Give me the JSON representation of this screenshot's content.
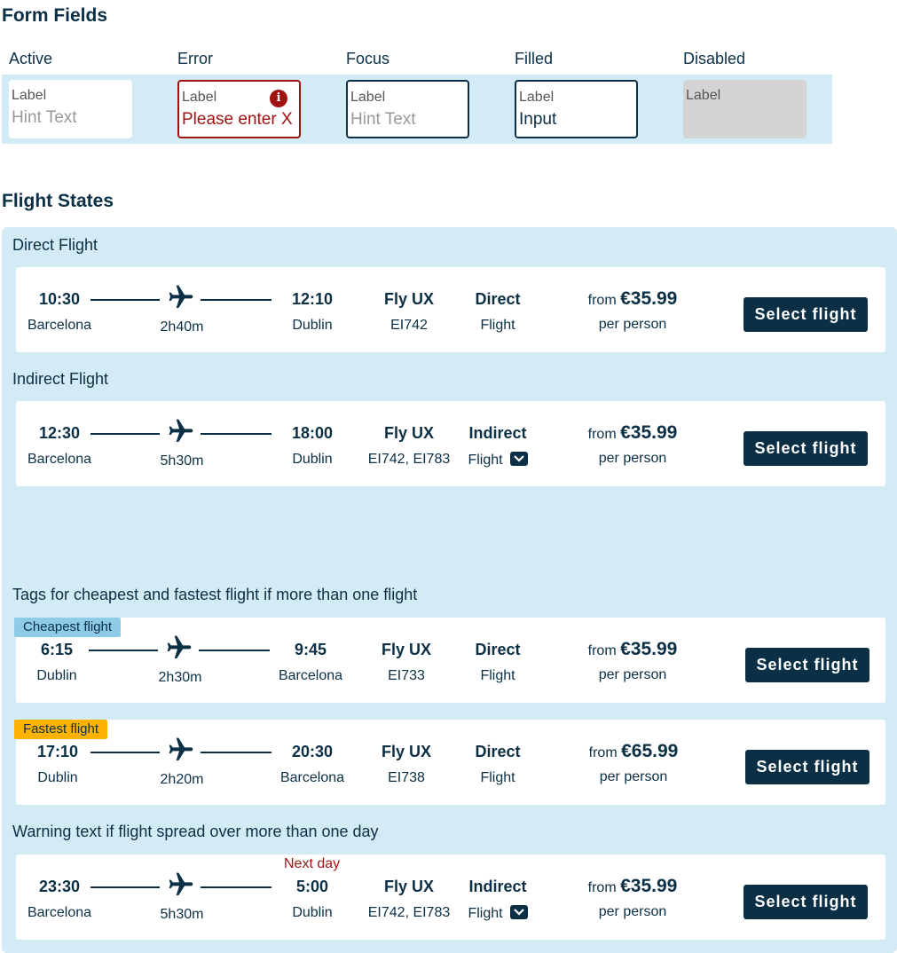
{
  "form_fields": {
    "title": "Form Fields",
    "states": [
      {
        "name": "Active",
        "label": "Label",
        "value": "Hint Text"
      },
      {
        "name": "Error",
        "label": "Label",
        "value": "Please enter X"
      },
      {
        "name": "Focus",
        "label": "Label",
        "value": "Hint Text"
      },
      {
        "name": "Filled",
        "label": "Label",
        "value": "Input"
      },
      {
        "name": "Disabled",
        "label": "Label",
        "value": ""
      }
    ],
    "error_icon": "i"
  },
  "flight_states": {
    "title": "Flight States",
    "sections": {
      "direct": "Direct Flight",
      "indirect": "Indirect Flight",
      "tags": "Tags for cheapest and fastest flight if more than one flight",
      "warning": "Warning text if flight spread over more than one day"
    },
    "tags": {
      "cheapest": "Cheapest flight",
      "fastest": "Fastest flight"
    },
    "next_day": "Next day",
    "price_prefix": "from",
    "per_person": "per person",
    "select_label": "Select flight",
    "flights": [
      {
        "dep_time": "10:30",
        "dep_city": "Barcelona",
        "duration": "2h40m",
        "arr_time": "12:10",
        "arr_city": "Dublin",
        "airline": "Fly UX",
        "code": "EI742",
        "stop_type": "Direct",
        "stop_sub": "Flight",
        "price": "€35.99"
      },
      {
        "dep_time": "12:30",
        "dep_city": "Barcelona",
        "duration": "5h30m",
        "arr_time": "18:00",
        "arr_city": "Dublin",
        "airline": "Fly UX",
        "code": "EI742, EI783",
        "stop_type": "Indirect",
        "stop_sub": "Flight",
        "price": "€35.99"
      },
      {
        "dep_time": "6:15",
        "dep_city": "Dublin",
        "duration": "2h30m",
        "arr_time": "9:45",
        "arr_city": "Barcelona",
        "airline": "Fly UX",
        "code": "EI733",
        "stop_type": "Direct",
        "stop_sub": "Flight",
        "price": "€35.99"
      },
      {
        "dep_time": "17:10",
        "dep_city": "Dublin",
        "duration": "2h20m",
        "arr_time": "20:30",
        "arr_city": "Barcelona",
        "airline": "Fly UX",
        "code": "EI738",
        "stop_type": "Direct",
        "stop_sub": "Flight",
        "price": "€65.99"
      },
      {
        "dep_time": "23:30",
        "dep_city": "Barcelona",
        "duration": "5h30m",
        "arr_time": "5:00",
        "arr_city": "Dublin",
        "airline": "Fly UX",
        "code": "EI742, EI783",
        "stop_type": "Indirect",
        "stop_sub": "Flight",
        "price": "€35.99"
      }
    ]
  },
  "colors": {
    "navy": "#0b2f45",
    "panel": "#d3ebf4",
    "error": "#a01313",
    "cheapest_tag": "#8ecbe6",
    "fastest_tag": "#ffb300",
    "disabled": "#d4d4d4"
  },
  "icons": {
    "plane": "airplane-icon",
    "chevron": "chevron-down-icon",
    "error": "error-info-icon"
  }
}
